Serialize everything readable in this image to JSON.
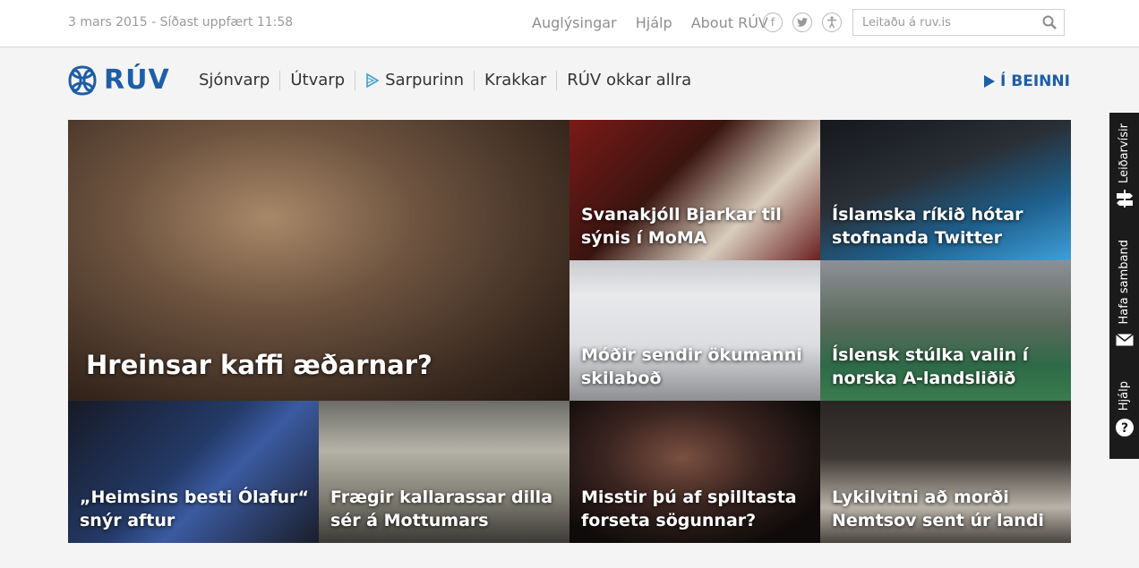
{
  "topbar": {
    "date": "3 mars 2015 - Síðast uppfært 11:58",
    "links": [
      "Auglýsingar",
      "Hjálp",
      "About RÚV"
    ],
    "social_icons": [
      "facebook-icon",
      "twitter-icon",
      "accessibility-icon"
    ],
    "search_placeholder": "Leitaðu á ruv.is"
  },
  "header": {
    "logo": "RÚV",
    "nav": [
      "Sjónvarp",
      "Útvarp",
      "Sarpurinn",
      "Krakkar",
      "RÚV okkar allra"
    ],
    "live": "Í BEINNI",
    "brand_color": "#1d5ea8"
  },
  "tiles": [
    {
      "title": "Hreinsar kaffi æðarnar?"
    },
    {
      "title": "Svanakjóll Bjarkar til sýnis í MoMA"
    },
    {
      "title": "Íslamska ríkið hótar stofnanda Twitter"
    },
    {
      "title": "Móðir sendir ökumanni skilaboð"
    },
    {
      "title": "Íslensk stúlka valin í norska A-landsliðið"
    },
    {
      "title": "„Heimsins besti Ólafur“ snýr aftur"
    },
    {
      "title": "Frægir kallarassar dilla sér á Mottumars"
    },
    {
      "title": "Misstir þú af spilltasta forseta sögunnar?"
    },
    {
      "title": "Lykilvitni að morði Nemtsov sent úr landi"
    }
  ],
  "sidetab": {
    "items": [
      "Leiðarvísir",
      "Hafa samband",
      "Hjálp"
    ]
  }
}
